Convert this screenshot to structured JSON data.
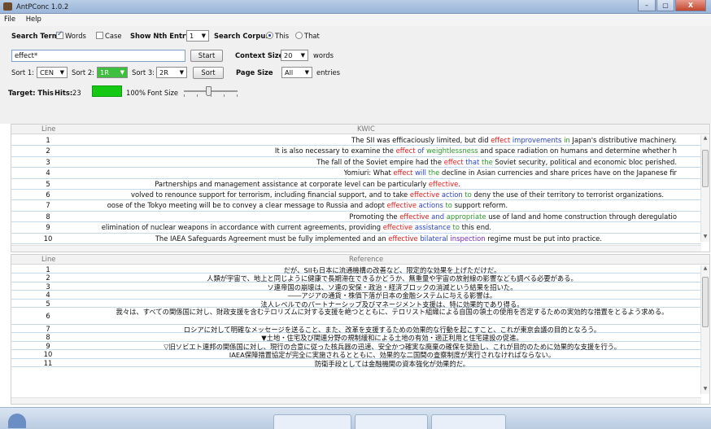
{
  "window": {
    "title": "AntPConc 1.0.2",
    "minimize": "–",
    "maximize": "▢",
    "close": "X"
  },
  "menu": [
    "File",
    "Help"
  ],
  "search": {
    "search_term_label": "Search Term",
    "words_label": "Words",
    "words_checked": true,
    "case_label": "Case",
    "case_checked": false,
    "nth_entry_label": "Show Nth Entry",
    "nth_entry_value": "1",
    "corpus_label": "Search Corpus",
    "corpus_this": "This",
    "corpus_that": "That",
    "corpus_selected": "This",
    "query": "effect*",
    "start_button": "Start",
    "context_size_label": "Context Size",
    "context_size_value": "20",
    "context_unit": "words"
  },
  "sort": {
    "sort1_label": "Sort 1:",
    "sort1_value": "CEN",
    "sort2_label": "Sort 2:",
    "sort2_value": "1R",
    "sort3_label": "Sort 3:",
    "sort3_value": "2R",
    "sort_button": "Sort",
    "page_size_label": "Page Size",
    "page_size_value": "All",
    "page_size_unit": "entries"
  },
  "target": {
    "target_label": "Target: This",
    "hits_label": "Hits:",
    "hits_value": "23",
    "progress_percent": 100,
    "progress_text": "100%",
    "font_size_label": "Font Size",
    "font_size_level": 0.45
  },
  "kwic": {
    "header_line": "Line",
    "header_text": "KWIC",
    "rows": [
      {
        "n": "1",
        "pre": "The SII was efficaciously limited, but did ",
        "kw": "effect",
        "r1": " improvements",
        "r2": " in",
        "post": " Japan's distributive machinery."
      },
      {
        "n": "2",
        "pre": "It is also necessary to examine the ",
        "kw": "effect",
        "r1": " of",
        "r2": " weightlessness",
        "post": " and space radiation on humans and determine whether h"
      },
      {
        "n": "3",
        "pre": "The fall of the Soviet empire had the ",
        "kw": "effect",
        "r1": " that",
        "r2": " the",
        "post": " Soviet security, political and economic bloc perished."
      },
      {
        "n": "4",
        "pre": "Yomiuri: What ",
        "kw": "effect",
        "r1": " will",
        "r2": " the",
        "post": " decline in Asian currencies and share prices have on the Japanese fir"
      },
      {
        "n": "5",
        "pre": "Partnerships and management assistance at corporate level can be particularly ",
        "kw": "effective",
        "r1": "",
        "r2": "",
        "post": "."
      },
      {
        "n": "6",
        "pre": "volved to renounce support for terrorism, including financial support, and to take ",
        "kw": "effective",
        "r1": " action",
        "r2": " to",
        "post": " deny the use of their territory to terrorist organizations."
      },
      {
        "n": "7",
        "pre": "oose of the Tokyo meeting will be to convey a clear message to Russia and adopt ",
        "kw": "effective",
        "r1": " actions",
        "r2": " to",
        "post": " support reform."
      },
      {
        "n": "8",
        "pre": "Promoting the ",
        "kw": "effective",
        "r1": " and",
        "r2": " appropriate",
        "post": " use of land and home construction through deregulatio"
      },
      {
        "n": "9",
        "pre": "elimination of nuclear weapons in accordance with current agreements, providing ",
        "kw": "effective",
        "r1": " assistance",
        "r2": " to",
        "post": " this end."
      },
      {
        "n": "10",
        "pre": "The IAEA Safeguards Agreement must be fully implemented and an ",
        "kw": "effective",
        "r1": " bilateral",
        "r2": " inspection",
        "post": " regime must be put into practice."
      }
    ]
  },
  "reference": {
    "header_line": "Line",
    "header_text": "Reference",
    "rows": [
      {
        "n": "1",
        "text": "だが、SIIも日本に流通機構の改善など、限定的な効果を上げただけだ。"
      },
      {
        "n": "2",
        "text": "人類が宇宙で、地上と同じように健康で長期滞在できるかどうか、無重量や宇宙の放射線の影響なども調べる必要がある。"
      },
      {
        "n": "3",
        "text": "ソ連帝国の崩壊は、ソ連の安保・政治・経済ブロックの消滅という結果を招いた。"
      },
      {
        "n": "4",
        "text": "――アジアの通貨・株価下落が日本の金融システムに与える影響は。"
      },
      {
        "n": "5",
        "text": "法人レベルでのパートナーシップ及びマネージメント支援は、特に効果的であり得る。"
      },
      {
        "n": "6",
        "text": "我々は、すべての関係国に対し、財政支援を含むテロリズムに対する支援を絶つとともに、テロリスト組織による自国の領土の使用を否定するための実効的な措置をとるよう求める。",
        "tall": true
      },
      {
        "n": "7",
        "text": "ロシアに対して明確なメッセージを送ること、また、改革を支援するための効果的な行動を起こすこと、これが東京会議の目的となろう。"
      },
      {
        "n": "8",
        "text": "▼土地・住宅及び関連分野の規制緩和による土地の有効・適正利用と住宅建設の促進。"
      },
      {
        "n": "9",
        "text": "▽旧ソビエト連邦の関係国に対し、現行の合意に従った核兵器の迅速、安全かつ確実な廃棄の確保を奨励し、これが目的のために効果的な支援を行う。"
      },
      {
        "n": "10",
        "text": "IAEA保障措置協定が完全に実施されるとともに、効果的な二国間の査察制度が実行されなければならない。"
      },
      {
        "n": "11",
        "text": "防衛手段としては金融機関の資本強化が効果的だ。"
      }
    ]
  }
}
